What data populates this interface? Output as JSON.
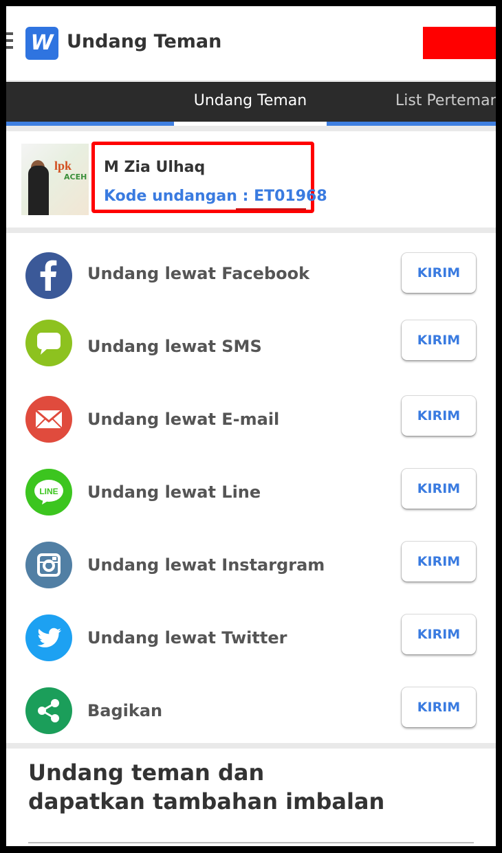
{
  "app": {
    "title": "Undang Teman",
    "logo_letter": "W"
  },
  "tabs": [
    {
      "label": "Undang Teman"
    },
    {
      "label": "List Perteman"
    }
  ],
  "profile": {
    "name": "M Zia Ulhaq",
    "code_label": "Kode undangan : ",
    "code": "ET01968"
  },
  "invite_options": [
    {
      "label": "Undang lewat Facebook",
      "icon": "facebook-icon",
      "button": "KIRIM",
      "color": "#3b5998"
    },
    {
      "label": "Undang lewat SMS",
      "icon": "sms-icon",
      "button": "KIRIM",
      "color": "#8dc21f"
    },
    {
      "label": "Undang lewat E-mail",
      "icon": "email-icon",
      "button": "KIRIM",
      "color": "#e04b3d"
    },
    {
      "label": "Undang lewat Line",
      "icon": "line-icon",
      "button": "KIRIM",
      "color": "#3cc51f"
    },
    {
      "label": "Undang lewat Instargram",
      "icon": "instagram-icon",
      "button": "KIRIM",
      "color": "#517fa4"
    },
    {
      "label": "Undang lewat Twitter",
      "icon": "twitter-icon",
      "button": "KIRIM",
      "color": "#1da1f2"
    },
    {
      "label": "Bagikan",
      "icon": "share-icon",
      "button": "KIRIM",
      "color": "#1b9e5a"
    }
  ],
  "promo": {
    "line1": "Undang teman dan",
    "line2": "dapatkan tambahan imbalan"
  },
  "colors": {
    "accent": "#3a7be0",
    "tabbar": "#2b2b2b",
    "highlight": "#ff0000"
  }
}
